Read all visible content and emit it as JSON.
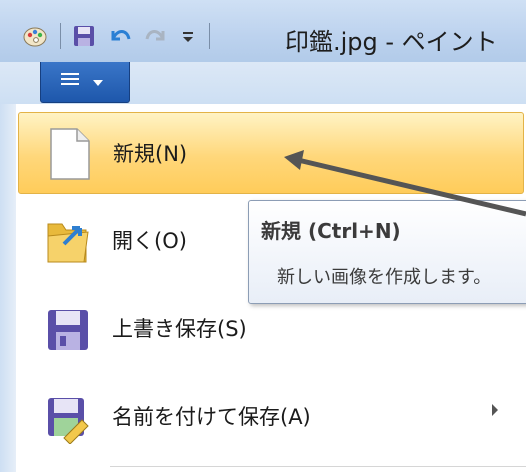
{
  "window": {
    "title": "印鑑.jpg - ペイント"
  },
  "quick_access": {
    "icons": [
      "paint-app-icon",
      "save-icon",
      "undo-icon",
      "redo-icon",
      "customize-dropdown-icon"
    ]
  },
  "file_menu_button": {
    "icon": "menu-list-icon"
  },
  "menu": {
    "items": [
      {
        "label": "新規(N)",
        "icon": "new-document-icon",
        "state": "hover"
      },
      {
        "label": "開く(O)",
        "icon": "open-folder-icon"
      },
      {
        "label": "上書き保存(S)",
        "icon": "save-icon"
      },
      {
        "label": "名前を付けて保存(A)",
        "icon": "save-as-icon",
        "has_submenu": true
      }
    ]
  },
  "tooltip": {
    "title": "新規 (Ctrl+N)",
    "description": "新しい画像を作成します。"
  },
  "colors": {
    "hover_bg": "#ffd77a",
    "file_button": "#2a66bb",
    "titlebar": "#c4d8f0"
  }
}
